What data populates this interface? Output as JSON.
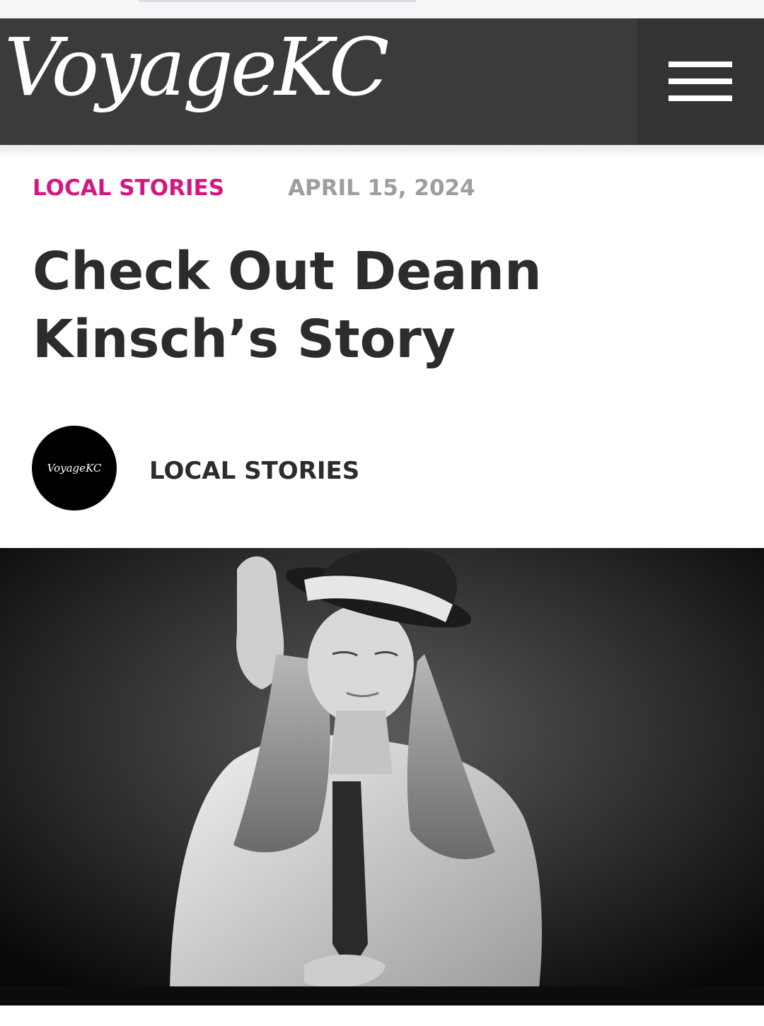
{
  "header": {
    "logo_text": "VoyageKC",
    "menu_icon": "hamburger-menu-icon"
  },
  "article": {
    "category": "LOCAL STORIES",
    "date": "APRIL 15, 2024",
    "title": "Check Out Deann Kinsch’s Story",
    "author": {
      "avatar_text": "VoyageKC",
      "name": "LOCAL STORIES"
    }
  },
  "colors": {
    "header_bg": "#3b3b3b",
    "menu_bg": "#333333",
    "category_accent": "#d2197f",
    "date_gray": "#9e9e9e",
    "title_text": "#2c2c2c"
  }
}
